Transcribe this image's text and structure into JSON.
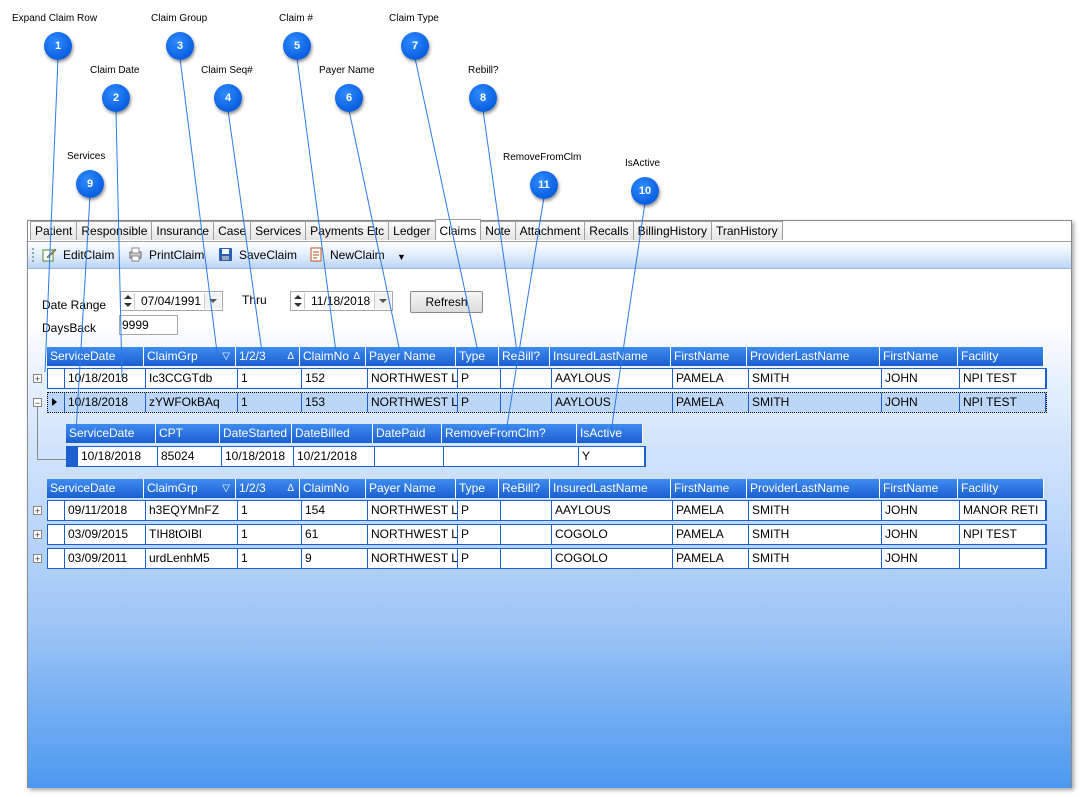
{
  "callouts": [
    {
      "num": "1",
      "label": "Expand Claim Row"
    },
    {
      "num": "2",
      "label": "Claim Date"
    },
    {
      "num": "3",
      "label": "Claim Group"
    },
    {
      "num": "4",
      "label": "Claim Seq#"
    },
    {
      "num": "5",
      "label": "Claim #"
    },
    {
      "num": "6",
      "label": "Payer Name"
    },
    {
      "num": "7",
      "label": "Claim Type"
    },
    {
      "num": "8",
      "label": "Rebill?"
    },
    {
      "num": "9",
      "label": "Services"
    },
    {
      "num": "10",
      "label": "IsActive"
    },
    {
      "num": "11",
      "label": "RemoveFromClm"
    }
  ],
  "tabs": [
    "Patient",
    "Responsible",
    "Insurance",
    "Case",
    "Services",
    "Payments Etc",
    "Ledger",
    "Claims",
    "Note",
    "Attachment",
    "Recalls",
    "BillingHistory",
    "TranHistory"
  ],
  "active_tab": "Claims",
  "toolbar": {
    "edit": "EditClaim",
    "print": "PrintClaim",
    "save": "SaveClaim",
    "new": "NewClaim"
  },
  "filters": {
    "date_range_label": "Date Range",
    "from_date": "07/04/1991",
    "thru_label": "Thru",
    "thru_date": "11/18/2018",
    "refresh": "Refresh",
    "days_back_label": "DaysBack",
    "days_back": "9999"
  },
  "claims_columns": [
    "ServiceDate",
    "ClaimGrp",
    "1/2/3",
    "ClaimNo",
    "Payer Name",
    "Type",
    "ReBill?",
    "InsuredLastName",
    "FirstName",
    "ProviderLastName",
    "FirstName",
    "Facility"
  ],
  "claims_top": [
    [
      "10/18/2018",
      "Ic3CCGTdb",
      "1",
      "152",
      "NORTHWEST L",
      "P",
      "",
      "AAYLOUS",
      "PAMELA",
      "SMITH",
      "JOHN",
      "NPI TEST"
    ],
    [
      "10/18/2018",
      "zYWFOkBAq",
      "1",
      "153",
      "NORTHWEST L",
      "P",
      "",
      "AAYLOUS",
      "PAMELA",
      "SMITH",
      "JOHN",
      "NPI TEST"
    ]
  ],
  "services_columns": [
    "ServiceDate",
    "CPT",
    "DateStarted",
    "DateBilled",
    "DatePaid",
    "RemoveFromClm?",
    "IsActive"
  ],
  "services_rows": [
    [
      "10/18/2018",
      "85024",
      "10/18/2018",
      "10/21/2018",
      "",
      "",
      "Y"
    ]
  ],
  "claims_bottom": [
    [
      "09/11/2018",
      "h3EQYMnFZ",
      "1",
      "154",
      "NORTHWEST L",
      "P",
      "",
      "AAYLOUS",
      "PAMELA",
      "SMITH",
      "JOHN",
      "MANOR RETI"
    ],
    [
      "03/09/2015",
      "TIH8tOIBl",
      "1",
      "61",
      "NORTHWEST L",
      "P",
      "",
      "COGOLO",
      "PAMELA",
      "SMITH",
      "JOHN",
      "NPI TEST"
    ],
    [
      "03/09/2011",
      "urdLenhM5",
      "1",
      "9",
      "NORTHWEST L",
      "P",
      "",
      "COGOLO",
      "PAMELA",
      "SMITH",
      "JOHN",
      ""
    ]
  ],
  "colors": {
    "header_blue": "#1c5fd0",
    "badge_blue": "#0a5fe0",
    "line_blue": "#2a7be8"
  }
}
